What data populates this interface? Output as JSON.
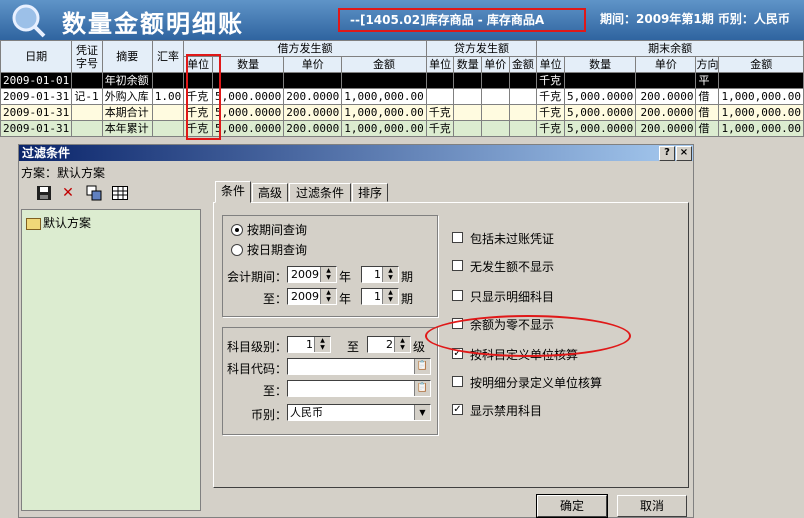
{
  "header": {
    "title": "数量金额明细账",
    "account": "--[1405.02]库存商品 - 库存商品A",
    "period_info": "期间：2009年第1期  币别：人民币"
  },
  "grid": {
    "headers": {
      "date": "日期",
      "voucher": "凭证字号",
      "summary": "摘要",
      "rate": "汇率",
      "debit_group": "借方发生额",
      "credit_group": "贷方发生额",
      "ending_group": "期末余额",
      "unit": "单位",
      "qty": "数量",
      "price": "单价",
      "amount": "金额",
      "direction": "方向"
    },
    "rows": [
      {
        "date": "2009-01-01",
        "voucher": "",
        "summary": "年初余额",
        "rate": "",
        "d_unit": "",
        "d_qty": "",
        "d_price": "",
        "d_amount": "",
        "c_unit": "",
        "c_qty": "",
        "c_price": "",
        "c_amount": "",
        "e_unit": "千克",
        "e_qty": "",
        "e_price": "",
        "e_dir": "平",
        "e_amount": ""
      },
      {
        "date": "2009-01-31",
        "voucher": "记-1",
        "summary": "外购入库",
        "rate": "1.00",
        "d_unit": "千克",
        "d_qty": "5,000.0000",
        "d_price": "200.0000",
        "d_amount": "1,000,000.00",
        "c_unit": "",
        "c_qty": "",
        "c_price": "",
        "c_amount": "",
        "e_unit": "千克",
        "e_qty": "5,000.0000",
        "e_price": "200.0000",
        "e_dir": "借",
        "e_amount": "1,000,000.00"
      },
      {
        "date": "2009-01-31",
        "voucher": "",
        "summary": "本期合计",
        "rate": "",
        "d_unit": "千克",
        "d_qty": "5,000.0000",
        "d_price": "200.0000",
        "d_amount": "1,000,000.00",
        "c_unit": "千克",
        "c_qty": "",
        "c_price": "",
        "c_amount": "",
        "e_unit": "千克",
        "e_qty": "5,000.0000",
        "e_price": "200.0000",
        "e_dir": "借",
        "e_amount": "1,000,000.00"
      },
      {
        "date": "2009-01-31",
        "voucher": "",
        "summary": "本年累计",
        "rate": "",
        "d_unit": "千克",
        "d_qty": "5,000.0000",
        "d_price": "200.0000",
        "d_amount": "1,000,000.00",
        "c_unit": "千克",
        "c_qty": "",
        "c_price": "",
        "c_amount": "",
        "e_unit": "千克",
        "e_qty": "5,000.0000",
        "e_price": "200.0000",
        "e_dir": "借",
        "e_amount": "1,000,000.00"
      }
    ]
  },
  "dialog": {
    "title": "过滤条件",
    "help": "?",
    "close": "×",
    "scheme_label": "方案：默认方案",
    "tree_item": "默认方案",
    "tabs": [
      "条件",
      "高级",
      "过滤条件",
      "排序"
    ],
    "query_by_period": "按期间查询",
    "query_by_date": "按日期查询",
    "accounting_period": "会计期间：",
    "to": "至：",
    "year_suffix": "年",
    "period_suffix": "期",
    "from_year": "2009",
    "from_period": "1",
    "to_year": "2009",
    "to_period": "1",
    "account_level": "科目级别：",
    "level_to": "至",
    "level_suffix": "级",
    "level_from": "1",
    "level_to_value": "2",
    "account_code": "科目代码：",
    "code_to": "至：",
    "currency_label": "币别：",
    "currency_value": "人民币",
    "checkboxes": [
      {
        "label": "包括未过账凭证",
        "checked": false
      },
      {
        "label": "无发生额不显示",
        "checked": false
      },
      {
        "label": "只显示明细科目",
        "checked": false
      },
      {
        "label": "余额为零不显示",
        "checked": false
      },
      {
        "label": "按科目定义单位核算",
        "checked": true
      },
      {
        "label": "按明细分录定义单位核算",
        "checked": false
      },
      {
        "label": "显示禁用科目",
        "checked": true
      }
    ],
    "ok": "确定",
    "cancel": "取消"
  },
  "colors": {
    "header_blue": "#2f64a0",
    "annotation_red": "#e01818",
    "tree_green": "#dcecd0"
  }
}
